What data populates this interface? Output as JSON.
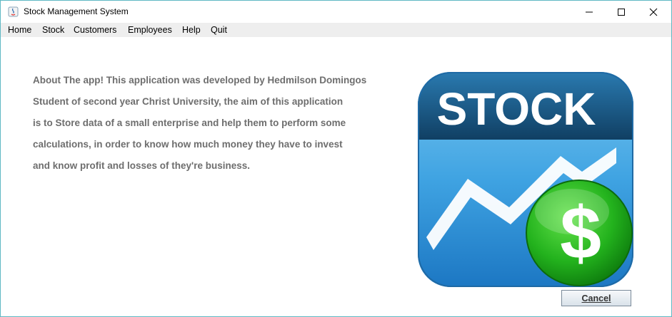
{
  "window": {
    "title": "Stock Management System"
  },
  "menu": {
    "items": [
      "Home",
      "Stock",
      "Customers",
      "Employees",
      "Help",
      "Quit"
    ]
  },
  "about": {
    "lines": [
      "About The app! This application was developed by Hedmilson Domingos",
      "Student of second year Christ University, the aim of this application",
      "is to Store data of a small enterprise and help them to perform some",
      "calculations, in order to know how much money they have to invest",
      "and know profit and losses of they're business."
    ]
  },
  "logo": {
    "text": "STOCK",
    "currency_symbol": "$"
  },
  "buttons": {
    "cancel": "Cancel"
  },
  "colors": {
    "accent_border": "#5fb8c4",
    "menubar_bg": "#eeeeee",
    "logo_blue": "#2f8fd8",
    "logo_dark": "#1b5a86",
    "coin_green": "#2eb82e"
  }
}
